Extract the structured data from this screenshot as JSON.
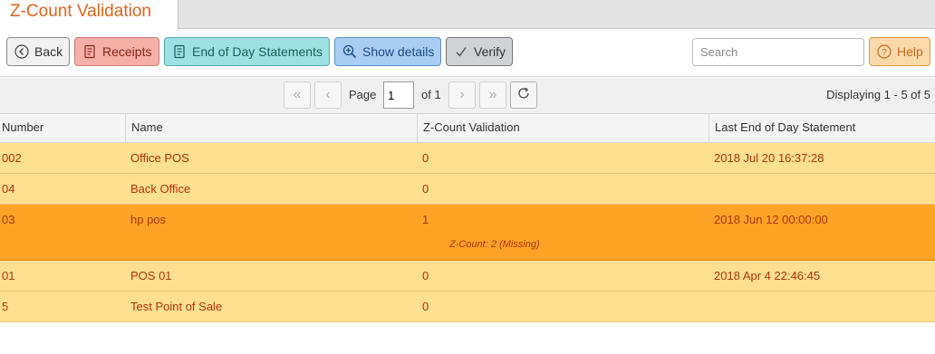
{
  "app": {
    "title": "Z-Count Validation"
  },
  "toolbar": {
    "back_label": "Back",
    "receipts_label": "Receipts",
    "eod_label": "End of Day Statements",
    "show_details_label": "Show details",
    "verify_label": "Verify",
    "search_placeholder": "Search",
    "help_label": "Help"
  },
  "pager": {
    "page_label": "Page",
    "current_page": "1",
    "of_label": "of 1",
    "display_label": "Displaying 1 - 5 of 5"
  },
  "columns": [
    "Number",
    "Name",
    "Z-Count Validation",
    "Last End of Day Statement"
  ],
  "rows": [
    {
      "number": "002",
      "name": "Office POS",
      "zcount": "0",
      "last_eod": "2018 Jul 20 16:37:28",
      "detail": ""
    },
    {
      "number": "04",
      "name": "Back Office",
      "zcount": "0",
      "last_eod": "",
      "detail": ""
    },
    {
      "number": "03",
      "name": "hp pos",
      "zcount": "1",
      "last_eod": "2018 Jun 12 00:00:00",
      "detail": "Z-Count: 2 (Missing)"
    },
    {
      "number": "01",
      "name": "POS 01",
      "zcount": "0",
      "last_eod": "2018 Apr 4 22:46:45",
      "detail": ""
    },
    {
      "number": "5",
      "name": "Test Point of Sale",
      "zcount": "0",
      "last_eod": "",
      "detail": ""
    }
  ],
  "colors": {
    "title": "#e0641b",
    "row_bg": "#ffdf90",
    "row_selected_bg": "#ffa327",
    "row_text": "#b1330b"
  }
}
